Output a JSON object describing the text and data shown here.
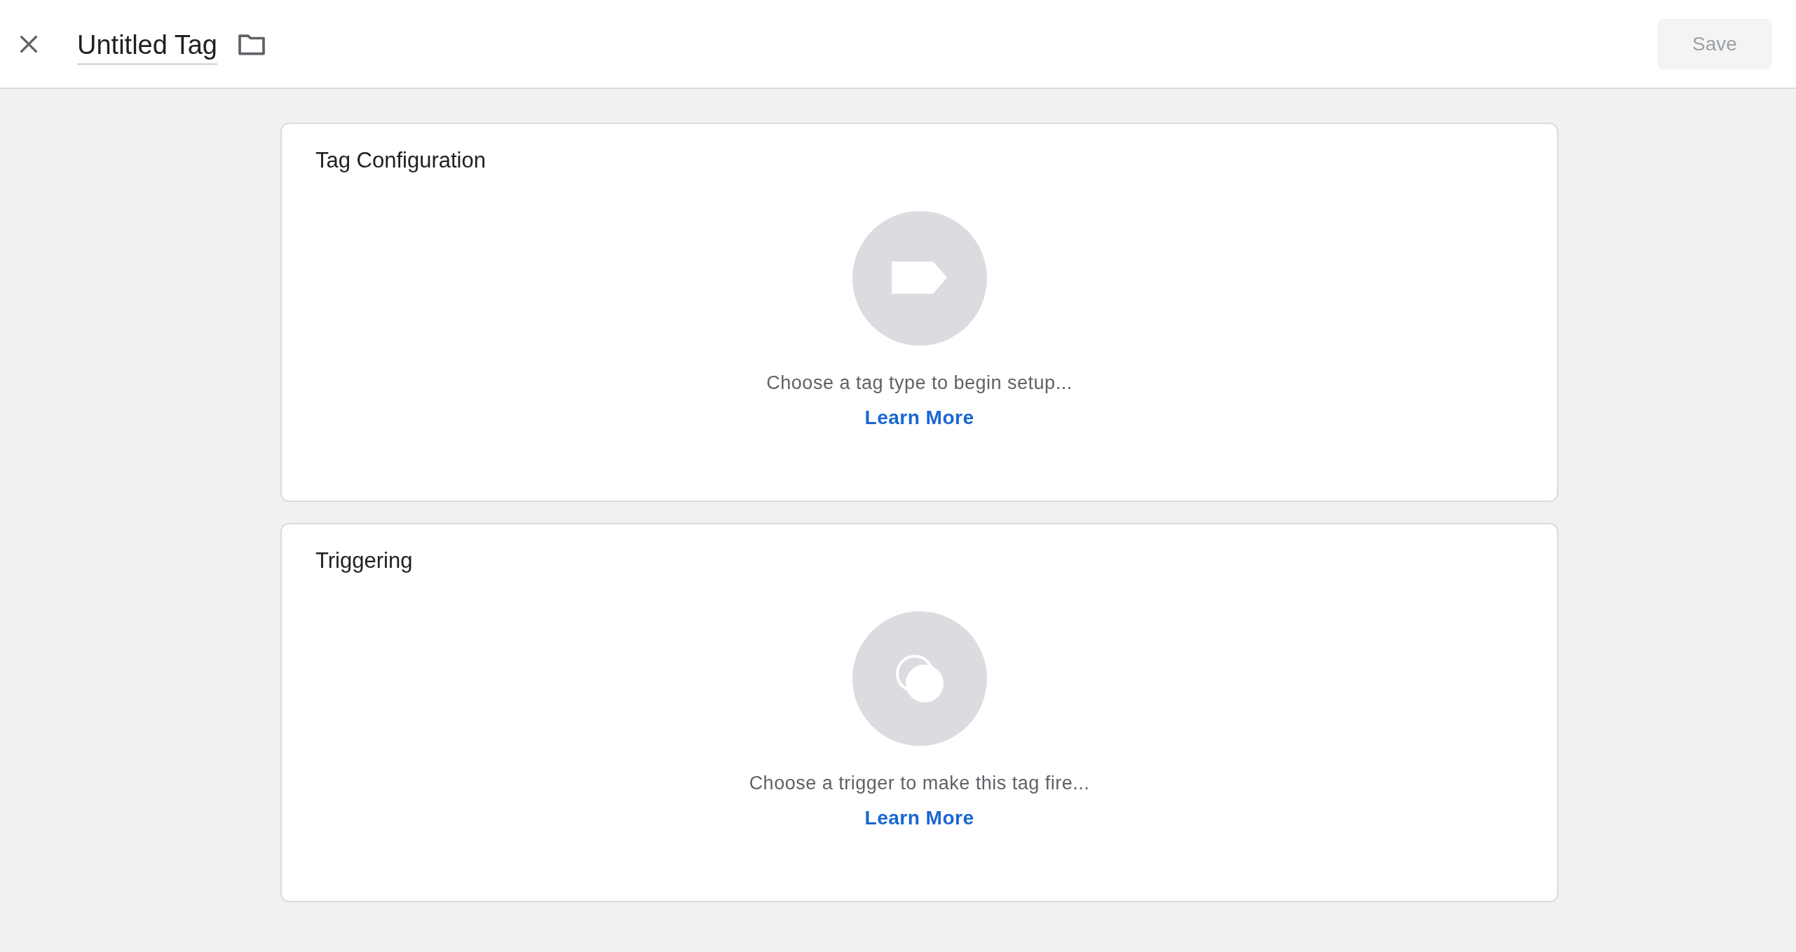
{
  "header": {
    "title": "Untitled Tag",
    "save_button": {
      "label": "Save",
      "disabled": true
    }
  },
  "cards": [
    {
      "kind": "tag",
      "title": "Tag Configuration",
      "hint": "Choose a tag type to begin setup...",
      "link": "Learn More"
    },
    {
      "kind": "trigger",
      "title": "Triggering",
      "hint": "Choose a trigger to make this tag fire...",
      "link": "Learn More"
    }
  ]
}
